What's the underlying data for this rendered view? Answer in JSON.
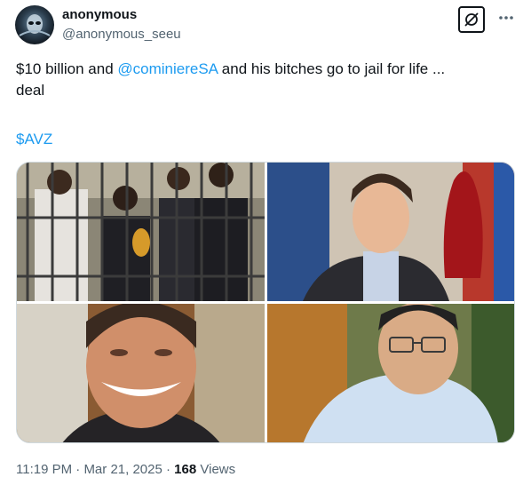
{
  "author": {
    "display_name": "anonymous",
    "handle": "@anonymous_seeu",
    "avatar_icon": "alien-mask-avatar"
  },
  "actions": {
    "grok_icon": "grok-icon",
    "more_icon": "more-icon"
  },
  "tweet": {
    "text_before": "$10 billion and ",
    "mention": "@cominiereSA",
    "text_after": " and his bitches go to jail for life ...\ndeal",
    "cashtag": "$AVZ"
  },
  "media": [
    {
      "kind": "photo",
      "position_word": "top-left"
    },
    {
      "kind": "photo",
      "position_word": "top-right"
    },
    {
      "kind": "photo",
      "position_word": "bottom-left"
    },
    {
      "kind": "photo",
      "position_word": "bottom-right"
    }
  ],
  "meta": {
    "time": "11:19 PM",
    "separator": "·",
    "date": "Mar 21, 2025",
    "views_count": "168",
    "views_label": "Views"
  },
  "colors": {
    "link": "#1d9bf0",
    "secondary_text": "#536471",
    "primary_text": "#0f1419",
    "border": "#cfd9de"
  }
}
